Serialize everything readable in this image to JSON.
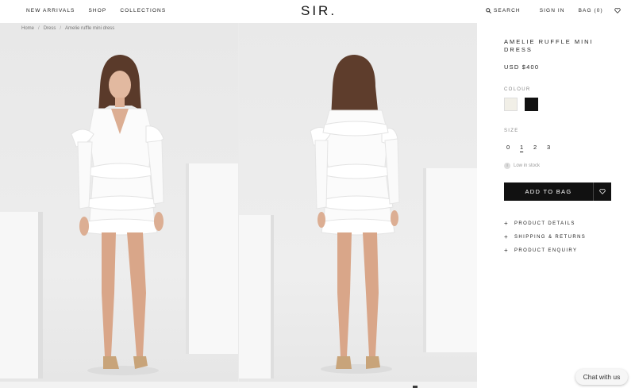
{
  "header": {
    "nav_left": [
      "NEW ARRIVALS",
      "SHOP",
      "COLLECTIONS"
    ],
    "logo": "SIR.",
    "search_label": "SEARCH",
    "signin_label": "SIGN IN",
    "bag_label": "BAG (0)"
  },
  "breadcrumb": [
    "Home",
    "Dress",
    "Amelie ruffle mini dress"
  ],
  "product": {
    "title": "AMELIE RUFFLE MINI DRESS",
    "price": "USD $400",
    "colour_label": "COLOUR",
    "colours": [
      {
        "name": "white",
        "hex": "#f1efe7"
      },
      {
        "name": "black",
        "hex": "#111111"
      }
    ],
    "size_label": "SIZE",
    "sizes": [
      "0",
      "1",
      "2",
      "3"
    ],
    "selected_size": "1",
    "stock_icon": "i",
    "stock_text": "Low in stock",
    "add_to_bag": "ADD TO BAG",
    "accordions": [
      "PRODUCT DETAILS",
      "SHIPPING & RETURNS",
      "PRODUCT ENQUIRY"
    ],
    "accordion_icon": "+"
  },
  "chat": {
    "label": "Chat with us"
  },
  "colors": {
    "accent": "#111111",
    "background": "#ffffff",
    "gallery_bg": "#ebebeb"
  }
}
